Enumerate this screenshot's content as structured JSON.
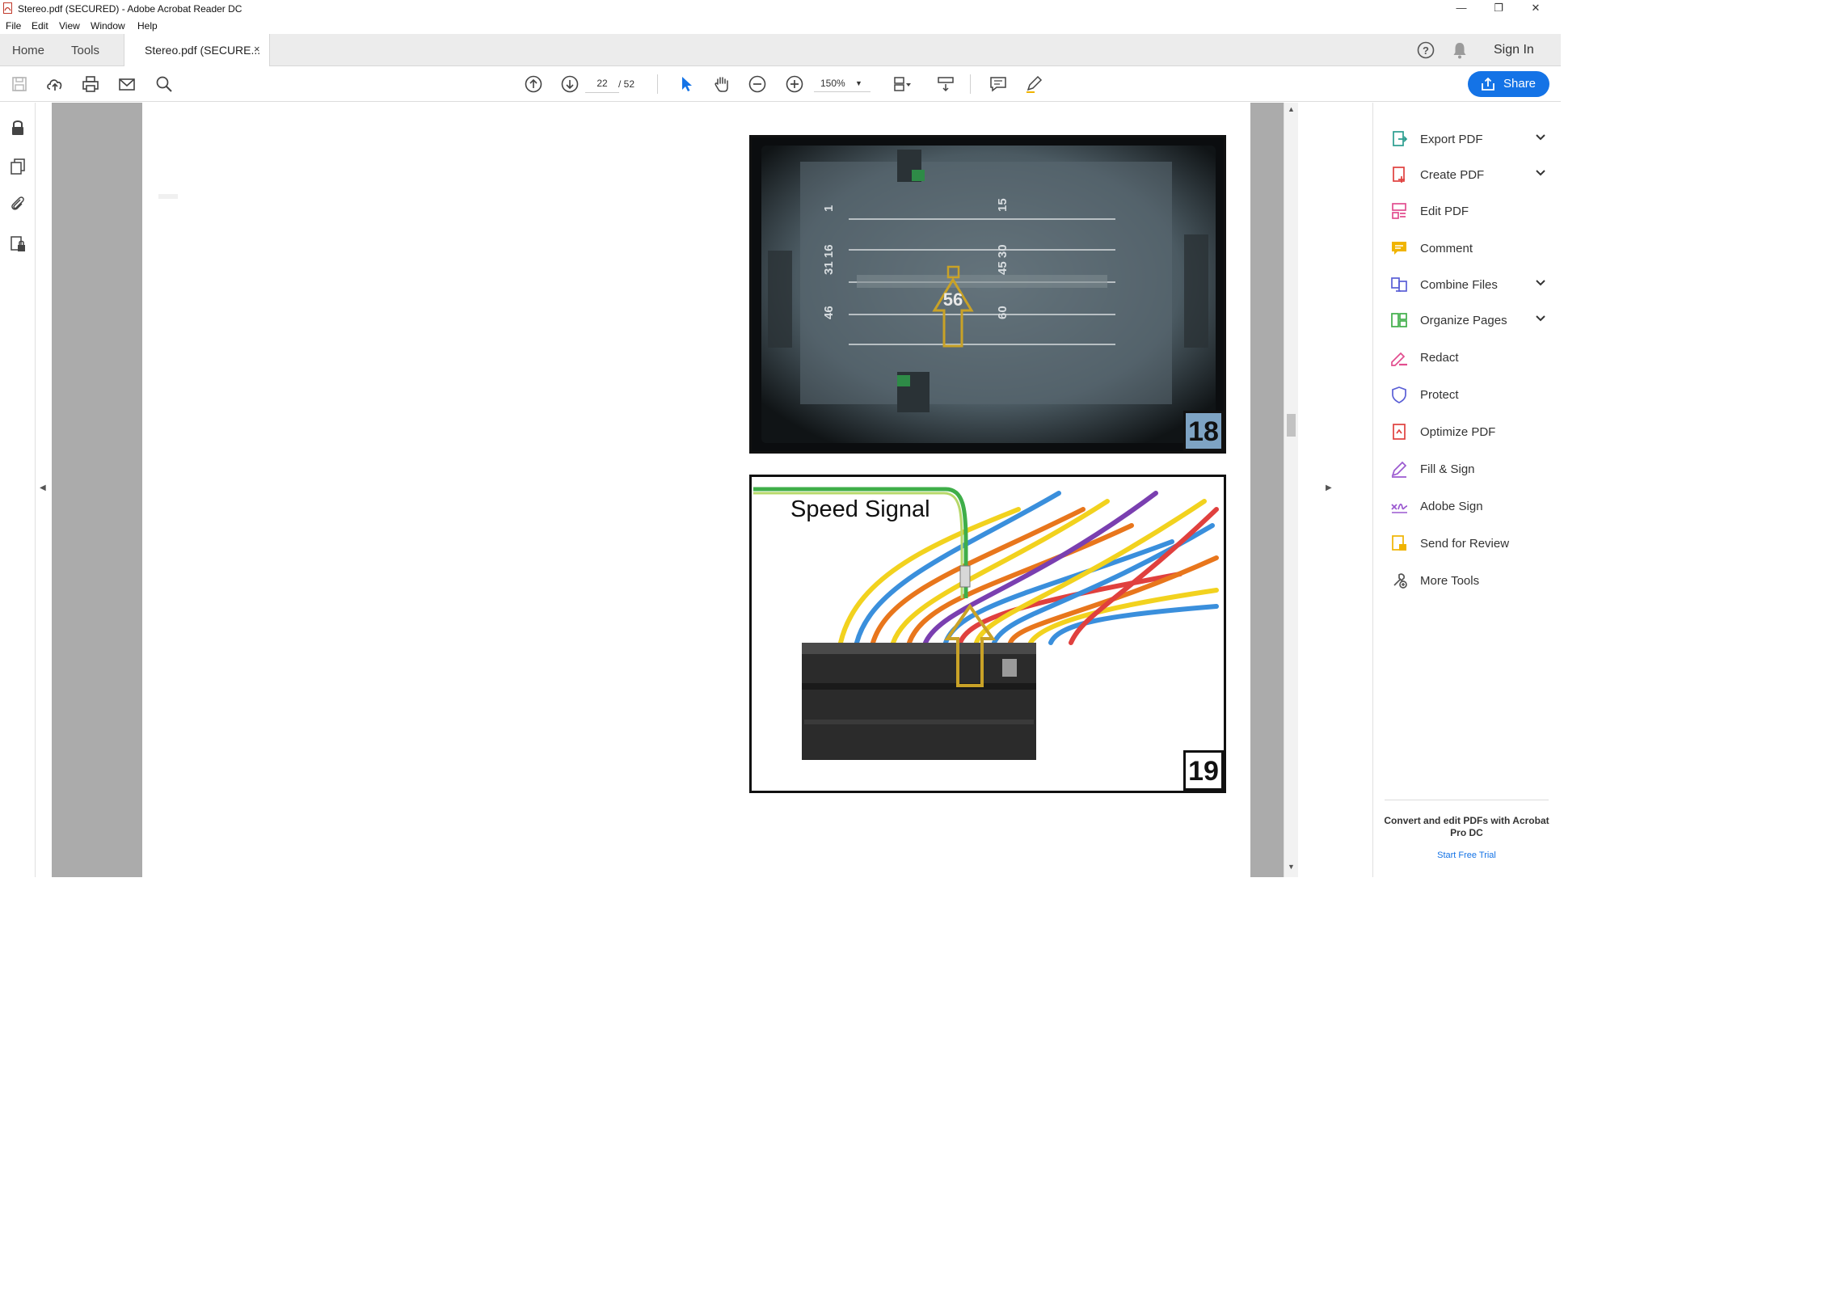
{
  "window": {
    "title": "Stereo.pdf (SECURED) - Adobe Acrobat Reader DC"
  },
  "menu": [
    "File",
    "Edit",
    "View",
    "Window",
    "Help"
  ],
  "tabs": {
    "home": "Home",
    "tools": "Tools",
    "document": "Stereo.pdf (SECURE...",
    "close": "×"
  },
  "header": {
    "signin": "Sign In"
  },
  "toolbar": {
    "page_current": "22",
    "page_total": "/ 52",
    "zoom": "150%",
    "share": "Share"
  },
  "figures": {
    "fig18": {
      "number": "18",
      "pin_label": "56",
      "pin_numbers": [
        "1",
        "15",
        "31 16",
        "45 30",
        "46",
        "60"
      ]
    },
    "fig19": {
      "number": "19",
      "caption": "Speed Signal"
    }
  },
  "tools_panel": {
    "items": [
      {
        "label": "Export PDF",
        "icon": "export-pdf-icon",
        "color": "#2a9d8f",
        "expandable": true
      },
      {
        "label": "Create PDF",
        "icon": "create-pdf-icon",
        "color": "#e0403e",
        "expandable": true
      },
      {
        "label": "Edit PDF",
        "icon": "edit-pdf-icon",
        "color": "#e24d8f",
        "expandable": false
      },
      {
        "label": "Comment",
        "icon": "comment-icon",
        "color": "#f0b400",
        "expandable": false
      },
      {
        "label": "Combine Files",
        "icon": "combine-files-icon",
        "color": "#5a5fd6",
        "expandable": true
      },
      {
        "label": "Organize Pages",
        "icon": "organize-pages-icon",
        "color": "#3fae49",
        "expandable": true
      },
      {
        "label": "Redact",
        "icon": "redact-icon",
        "color": "#e24d8f",
        "expandable": false
      },
      {
        "label": "Protect",
        "icon": "protect-icon",
        "color": "#5a5fd6",
        "expandable": false
      },
      {
        "label": "Optimize PDF",
        "icon": "optimize-pdf-icon",
        "color": "#e0403e",
        "expandable": false
      },
      {
        "label": "Fill & Sign",
        "icon": "fill-sign-icon",
        "color": "#9b59d0",
        "expandable": false
      },
      {
        "label": "Adobe Sign",
        "icon": "adobe-sign-icon",
        "color": "#9b59d0",
        "expandable": false
      },
      {
        "label": "Send for Review",
        "icon": "send-review-icon",
        "color": "#f0b400",
        "expandable": false
      },
      {
        "label": "More Tools",
        "icon": "more-tools-icon",
        "color": "#555555",
        "expandable": false
      }
    ],
    "promo": "Convert and edit PDFs with Acrobat Pro DC",
    "trial": "Start Free Trial"
  },
  "colors": {
    "accent": "#1473e6",
    "arrow": "#c9a227"
  }
}
